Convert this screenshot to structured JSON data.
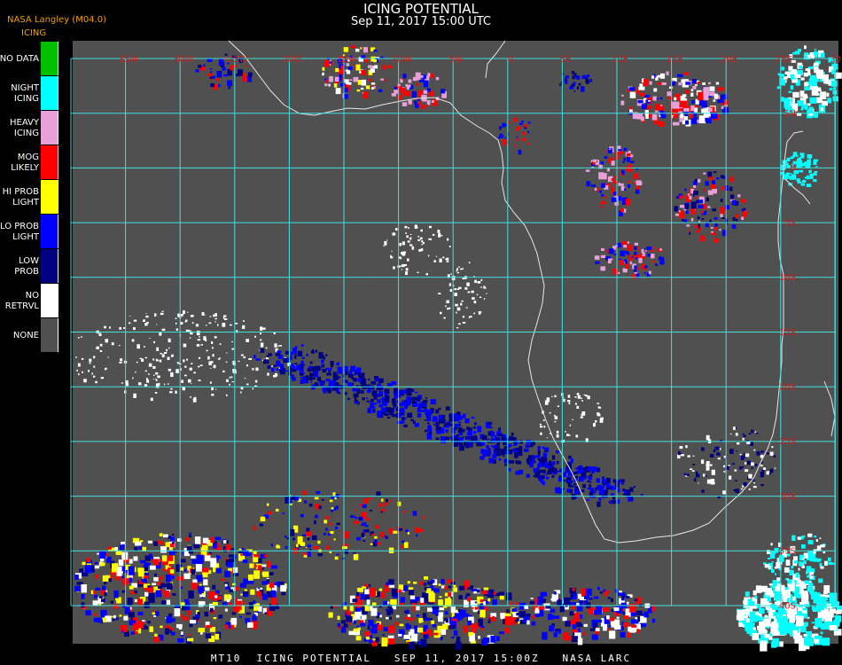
{
  "header": {
    "title": "ICING POTENTIAL",
    "subtitle": "Sep 11, 2017 15:00 UTC",
    "producer": "NASA Langley (M04.0)",
    "product": "ICING"
  },
  "legend": [
    {
      "label": "NO DATA",
      "color": "#00c000"
    },
    {
      "label": "NIGHT\nICING",
      "color": "#00ffff"
    },
    {
      "label": "HEAVY\nICING",
      "color": "#e8a0d8"
    },
    {
      "label": "MOG\nLIKELY",
      "color": "#ff0000"
    },
    {
      "label": "HI PROB\nLIGHT",
      "color": "#ffff00"
    },
    {
      "label": "LO PROB\nLIGHT",
      "color": "#0000ff"
    },
    {
      "label": "LOW\nPROB",
      "color": "#000080"
    },
    {
      "label": "NO\nRETRVL",
      "color": "#ffffff"
    },
    {
      "label": "NONE",
      "color": "#505050"
    }
  ],
  "map": {
    "background_color": "#505050",
    "grid_color": "#40e0e0",
    "coastline_color": "#e8e8e8",
    "lon_labels": [
      "35W",
      "30W",
      "25W",
      "20W",
      "15W",
      "10W",
      "5W",
      "0",
      "5E",
      "10E",
      "15E",
      "20E",
      "25E",
      "30E",
      "35E"
    ],
    "lat_labels": [
      "5N",
      "0",
      "5S",
      "10S",
      "15S",
      "20S",
      "25S",
      "30S",
      "35S",
      "40S"
    ]
  },
  "footer": "MT10  ICING POTENTIAL   SEP 11, 2017 15:00Z   NASA LARC"
}
